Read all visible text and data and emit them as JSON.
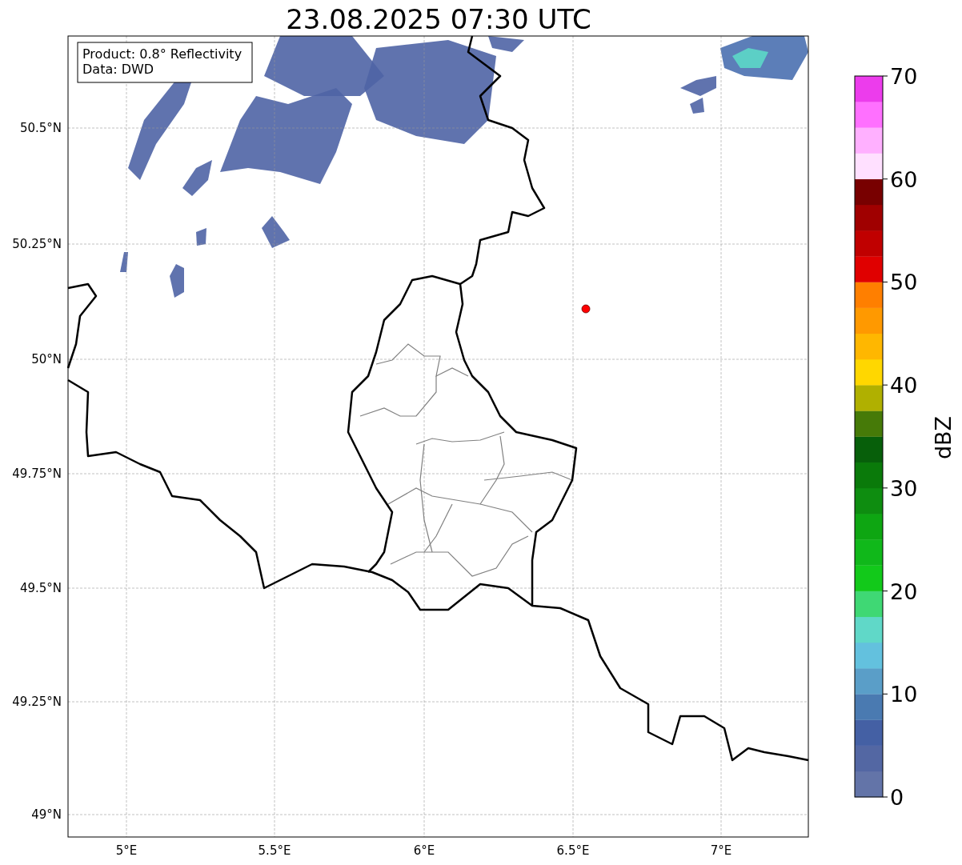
{
  "title": "23.08.2025 07:30 UTC",
  "info_box": {
    "lines": [
      "Product: 0.8° Reflectivity",
      "Data: DWD"
    ]
  },
  "map": {
    "lat_ticks": [
      "50.5°N",
      "50.25°N",
      "50°N",
      "49.75°N",
      "49.5°N",
      "49.25°N",
      "49°N"
    ],
    "lon_ticks": [
      "5°E",
      "5.5°E",
      "6°E",
      "6.5°E",
      "7°E"
    ]
  },
  "colorbar": {
    "label": "dBZ",
    "ticks": [
      "70",
      "60",
      "50",
      "40",
      "30",
      "20",
      "10",
      "0"
    ],
    "segments": [
      {
        "color": "#6374a8"
      },
      {
        "color": "#5367a3"
      },
      {
        "color": "#4460a4"
      },
      {
        "color": "#4a7ab1"
      },
      {
        "color": "#5a9ec8"
      },
      {
        "color": "#63c1de"
      },
      {
        "color": "#60d8c8"
      },
      {
        "color": "#3fd874"
      },
      {
        "color": "#12c91a"
      },
      {
        "color": "#10b81a"
      },
      {
        "color": "#0ea612"
      },
      {
        "color": "#0e8d10"
      },
      {
        "color": "#0a7a0a"
      },
      {
        "color": "#075f0a"
      },
      {
        "color": "#467a08"
      },
      {
        "color": "#b0b000"
      },
      {
        "color": "#ffd700"
      },
      {
        "color": "#ffb700"
      },
      {
        "color": "#ff9900"
      },
      {
        "color": "#ff7f00"
      },
      {
        "color": "#e00000"
      },
      {
        "color": "#c00000"
      },
      {
        "color": "#a00000"
      },
      {
        "color": "#780000"
      },
      {
        "color": "#ffe0ff"
      },
      {
        "color": "#ffb0ff"
      },
      {
        "color": "#ff70ff"
      },
      {
        "color": "#ec3cec"
      }
    ]
  }
}
